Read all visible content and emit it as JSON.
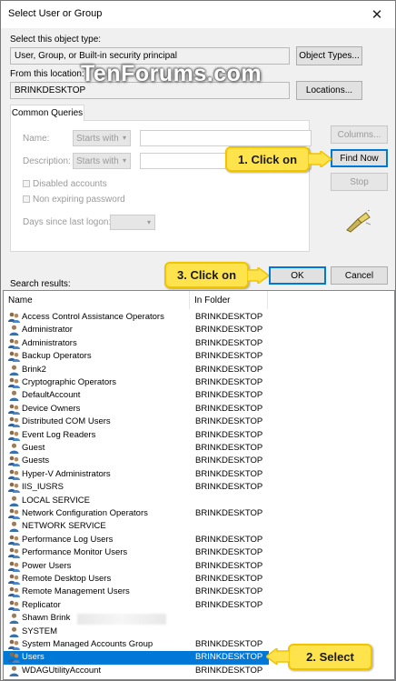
{
  "window": {
    "title": "Select User or Group",
    "close_glyph": "✕"
  },
  "watermark": "TenForums.com",
  "object_type": {
    "label": "Select this object type:",
    "value": "User, Group, or Built-in security principal",
    "button": "Object Types..."
  },
  "location": {
    "label": "From this location:",
    "value": "BRINKDESKTOP",
    "button": "Locations..."
  },
  "common_queries": {
    "tab_label": "Common Queries",
    "name_label": "Name:",
    "name_match": "Starts with",
    "description_label": "Description:",
    "description_match": "Starts with",
    "disabled_accounts": "Disabled accounts",
    "non_expiring_password": "Non expiring password",
    "days_since_logon": "Days since last logon:",
    "dropdown_arrow": "▾"
  },
  "buttons": {
    "columns": "Columns...",
    "find_now": "Find Now",
    "stop": "Stop",
    "ok": "OK",
    "cancel": "Cancel"
  },
  "callouts": {
    "step1": "1. Click on",
    "step2": "2. Select",
    "step3": "3. Click on",
    "color": "#ffe34d"
  },
  "results": {
    "label": "Search results:",
    "col_name": "Name",
    "col_folder": "In Folder",
    "selected_color": "#0078d7",
    "rows": [
      {
        "name": "Access Control Assistance Operators",
        "folder": "BRINKDESKTOP",
        "icon": "group-icon"
      },
      {
        "name": "Administrator",
        "folder": "BRINKDESKTOP",
        "icon": "user-icon"
      },
      {
        "name": "Administrators",
        "folder": "BRINKDESKTOP",
        "icon": "group-icon"
      },
      {
        "name": "Backup Operators",
        "folder": "BRINKDESKTOP",
        "icon": "group-icon"
      },
      {
        "name": "Brink2",
        "folder": "BRINKDESKTOP",
        "icon": "user-icon"
      },
      {
        "name": "Cryptographic Operators",
        "folder": "BRINKDESKTOP",
        "icon": "group-icon"
      },
      {
        "name": "DefaultAccount",
        "folder": "BRINKDESKTOP",
        "icon": "user-icon"
      },
      {
        "name": "Device Owners",
        "folder": "BRINKDESKTOP",
        "icon": "group-icon"
      },
      {
        "name": "Distributed COM Users",
        "folder": "BRINKDESKTOP",
        "icon": "group-icon"
      },
      {
        "name": "Event Log Readers",
        "folder": "BRINKDESKTOP",
        "icon": "group-icon"
      },
      {
        "name": "Guest",
        "folder": "BRINKDESKTOP",
        "icon": "user-icon"
      },
      {
        "name": "Guests",
        "folder": "BRINKDESKTOP",
        "icon": "group-icon"
      },
      {
        "name": "Hyper-V Administrators",
        "folder": "BRINKDESKTOP",
        "icon": "group-icon"
      },
      {
        "name": "IIS_IUSRS",
        "folder": "BRINKDESKTOP",
        "icon": "group-icon"
      },
      {
        "name": "LOCAL SERVICE",
        "folder": "",
        "icon": "user-icon"
      },
      {
        "name": "Network Configuration Operators",
        "folder": "BRINKDESKTOP",
        "icon": "group-icon"
      },
      {
        "name": "NETWORK SERVICE",
        "folder": "",
        "icon": "user-icon"
      },
      {
        "name": "Performance Log Users",
        "folder": "BRINKDESKTOP",
        "icon": "group-icon"
      },
      {
        "name": "Performance Monitor Users",
        "folder": "BRINKDESKTOP",
        "icon": "group-icon"
      },
      {
        "name": "Power Users",
        "folder": "BRINKDESKTOP",
        "icon": "group-icon"
      },
      {
        "name": "Remote Desktop Users",
        "folder": "BRINKDESKTOP",
        "icon": "group-icon"
      },
      {
        "name": "Remote Management Users",
        "folder": "BRINKDESKTOP",
        "icon": "group-icon"
      },
      {
        "name": "Replicator",
        "folder": "BRINKDESKTOP",
        "icon": "group-icon"
      },
      {
        "name": "Shawn Brink",
        "folder": "",
        "icon": "user-icon"
      },
      {
        "name": "SYSTEM",
        "folder": "",
        "icon": "user-icon"
      },
      {
        "name": "System Managed Accounts Group",
        "folder": "BRINKDESKTOP",
        "icon": "group-icon"
      },
      {
        "name": "Users",
        "folder": "BRINKDESKTOP",
        "icon": "group-icon",
        "selected": true
      },
      {
        "name": "WDAGUtilityAccount",
        "folder": "BRINKDESKTOP",
        "icon": "user-icon"
      }
    ]
  }
}
